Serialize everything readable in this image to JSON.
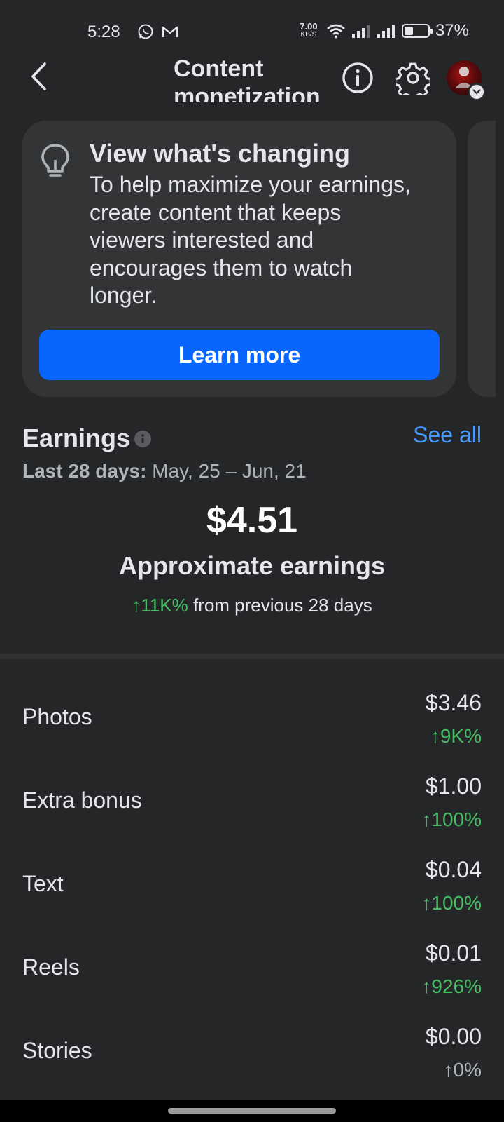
{
  "status_bar": {
    "time": "5:28",
    "net_speed_value": "7.00",
    "net_speed_unit": "KB/S",
    "battery_percent": "37%",
    "battery_level": 0.37
  },
  "header": {
    "title": "Content monetization"
  },
  "promo": {
    "title": "View what's changing",
    "body": "To help maximize your earnings, create content that keeps viewers interested and encourages them to watch longer.",
    "button_label": "Learn more"
  },
  "earnings": {
    "title": "Earnings",
    "see_all_label": "See all",
    "period_label": "Last 28 days:",
    "period_range": "May, 25 – Jun, 21",
    "amount": "$4.51",
    "amount_label": "Approximate earnings",
    "change": "↑11K%",
    "change_suffix": "from previous 28 days"
  },
  "breakdown": [
    {
      "name": "Photos",
      "value": "$3.46",
      "change": "↑9K%",
      "trend": "up"
    },
    {
      "name": "Extra bonus",
      "value": "$1.00",
      "change": "↑100%",
      "trend": "up"
    },
    {
      "name": "Text",
      "value": "$0.04",
      "change": "↑100%",
      "trend": "up"
    },
    {
      "name": "Reels",
      "value": "$0.01",
      "change": "↑926%",
      "trend": "up"
    },
    {
      "name": "Stories",
      "value": "$0.00",
      "change": "↑0%",
      "trend": "flat"
    }
  ],
  "colors": {
    "background": "#252628",
    "card": "#333436",
    "primary_button": "#0866ff",
    "link": "#4599ff",
    "positive": "#45bd62"
  }
}
